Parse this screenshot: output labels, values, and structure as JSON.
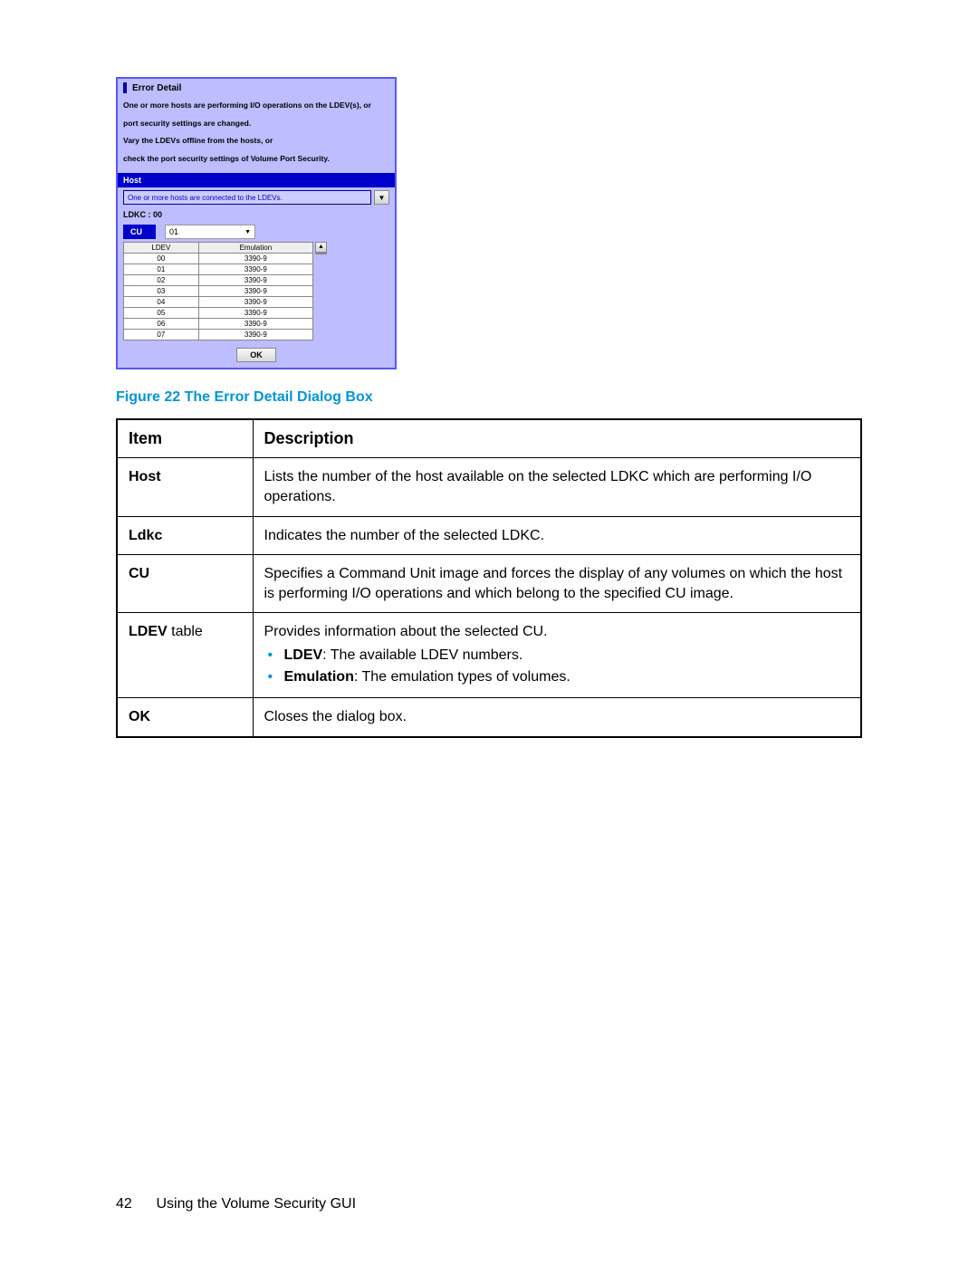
{
  "dialog": {
    "title": "Error Detail",
    "msg1": "One or more hosts are performing I/O operations on the LDEV(s), or",
    "msg2": "port security settings are changed.",
    "msg3": "Vary the LDEVs offline from the hosts, or",
    "msg4": "check the port security settings of Volume Port Security.",
    "host_label": "Host",
    "host_dropdown": "One or more hosts are connected to the LDEVs.",
    "ldkc_label": "LDKC : 00",
    "cu_label": "CU",
    "cu_value": "01",
    "table_headers": {
      "ldev": "LDEV",
      "emu": "Emulation"
    },
    "rows": [
      {
        "ldev": "00",
        "emu": "3390-9"
      },
      {
        "ldev": "01",
        "emu": "3390-9"
      },
      {
        "ldev": "02",
        "emu": "3390-9"
      },
      {
        "ldev": "03",
        "emu": "3390-9"
      },
      {
        "ldev": "04",
        "emu": "3390-9"
      },
      {
        "ldev": "05",
        "emu": "3390-9"
      },
      {
        "ldev": "06",
        "emu": "3390-9"
      },
      {
        "ldev": "07",
        "emu": "3390-9"
      }
    ],
    "ok": "OK"
  },
  "figure_caption": "Figure 22 The Error Detail Dialog Box",
  "desc_table": {
    "headers": {
      "item": "Item",
      "desc": "Description"
    },
    "rows": {
      "host": {
        "item": "Host",
        "desc": "Lists the number of the host available on the selected LDKC which are performing I/O operations."
      },
      "ldkc": {
        "item": "Ldkc",
        "desc": "Indicates the number of the selected LDKC."
      },
      "cu": {
        "item": "CU",
        "desc": "Specifies a Command Unit image and forces the display of any volumes on which the host is performing I/O operations and which belong to the specified CU image."
      },
      "ldev": {
        "item_bold": "LDEV",
        "item_suffix": " table",
        "intro": "Provides information about the selected CU.",
        "bullet1_label": "LDEV",
        "bullet1_text": ": The available LDEV numbers.",
        "bullet2_label": "Emulation",
        "bullet2_text": ": The emulation types of volumes."
      },
      "ok": {
        "item": "OK",
        "desc": "Closes the dialog box."
      }
    }
  },
  "footer": {
    "page": "42",
    "title": "Using the Volume Security GUI"
  }
}
